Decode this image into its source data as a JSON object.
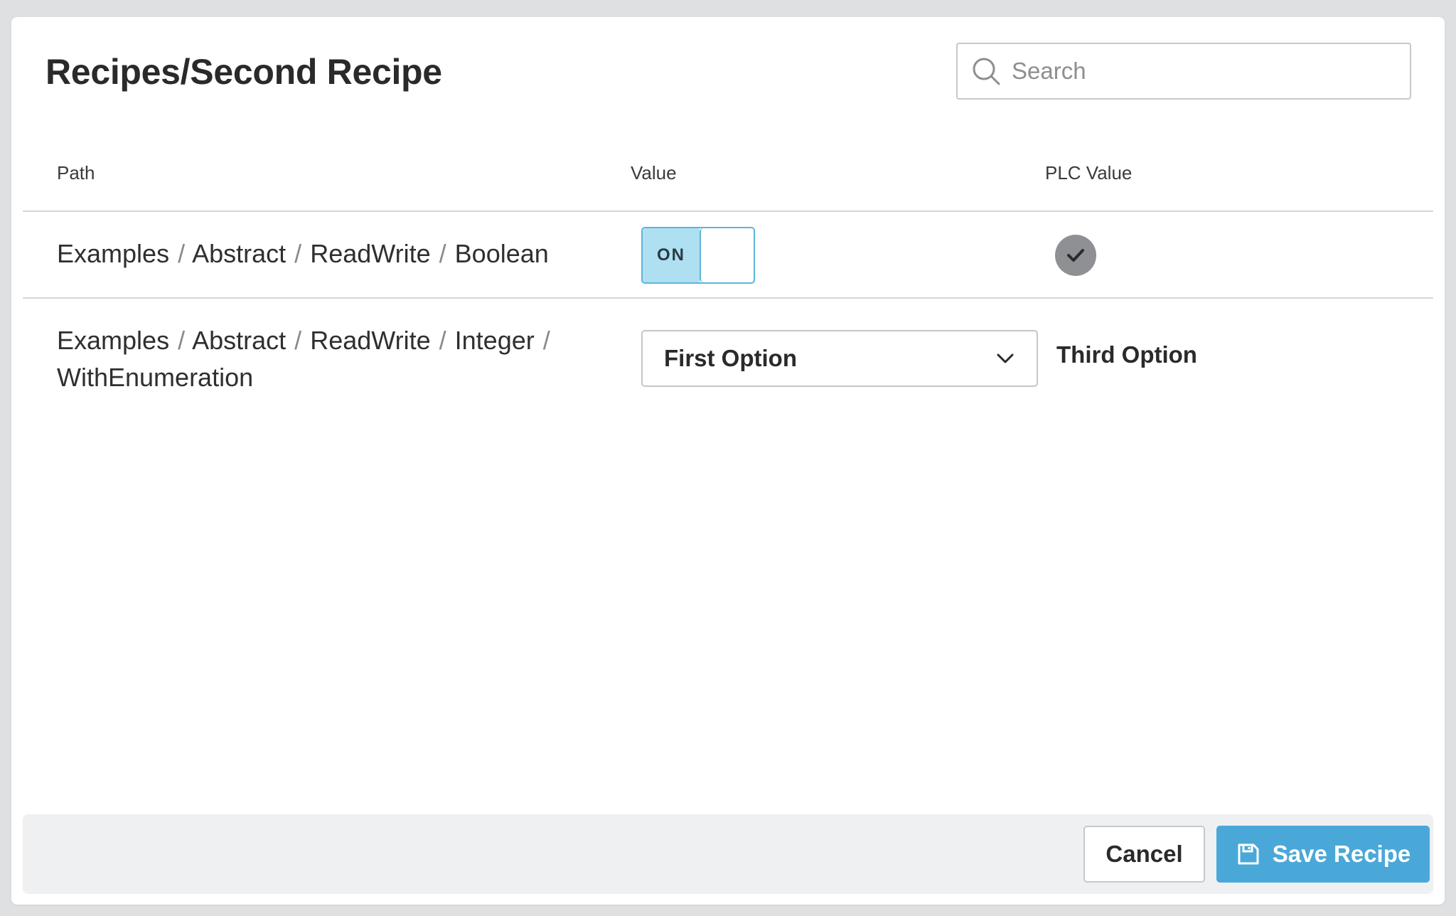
{
  "dialog": {
    "title": "Recipes/Second Recipe"
  },
  "search": {
    "placeholder": "Search",
    "icon": "search-icon"
  },
  "table": {
    "columns": [
      "Path",
      "Value",
      "PLC Value"
    ],
    "rows": [
      {
        "path_segments": [
          "Examples",
          "Abstract",
          "ReadWrite",
          "Boolean"
        ],
        "separator": "/",
        "value_type": "toggle",
        "value_label": "ON",
        "plc_value_icon": "check-icon"
      },
      {
        "path_segments": [
          "Examples",
          "Abstract",
          "ReadWrite",
          "Integer",
          "WithEnumeration"
        ],
        "separator": "/",
        "value_type": "select",
        "selected_option": "First Option",
        "plc_value": "Third Option"
      }
    ]
  },
  "footer": {
    "cancel_label": "Cancel",
    "save_label": "Save Recipe",
    "save_icon": "save-icon"
  },
  "colors": {
    "accent": "#4aa8d8",
    "toggle_on": "#aee0f1",
    "check_badge": "#8e9093"
  }
}
